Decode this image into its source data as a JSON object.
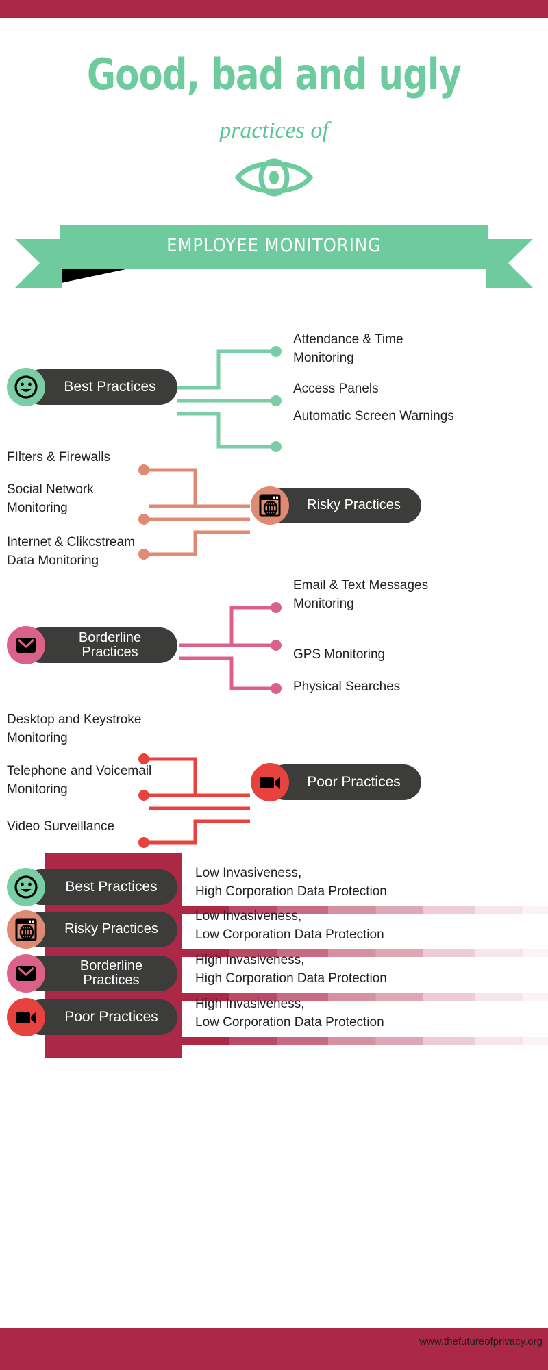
{
  "brand": {
    "bar_color": "#AB2847",
    "accent_green": "#6DCB9E",
    "footer_url": "www.thefutureofprivacy.org"
  },
  "hero": {
    "title": "Good, bad and ugly",
    "subtitle": "practices of",
    "eye_icon": "eye-icon",
    "ribbon_label": "EMPLOYEE MONITORING"
  },
  "branches": [
    {
      "key": "best",
      "label": "Best Practices",
      "icon": "smiley-face-icon",
      "color": "#7ACEA5",
      "side": "right",
      "items": [
        "Attendance & Time Monitoring",
        "Access Panels",
        "Automatic Screen Warnings"
      ]
    },
    {
      "key": "risky",
      "label": "Risky Practices",
      "icon": "browser-globe-icon",
      "color": "#DF8A72",
      "side": "left",
      "items": [
        "FIlters & Firewalls",
        "Social Network Monitoring",
        "Internet & Clikcstream Data Monitoring"
      ]
    },
    {
      "key": "borderline",
      "label": "Borderline Practices",
      "icon": "envelope-icon",
      "color": "#DC6189",
      "side": "right",
      "items": [
        "Email & Text Messages Monitoring",
        "GPS Monitoring",
        "Physical Searches"
      ]
    },
    {
      "key": "poor",
      "label": "Poor Practices",
      "icon": "video-camera-icon",
      "color": "#E8423E",
      "side": "left",
      "items": [
        "Desktop and Keystroke Monitoring",
        "Telephone and Voicemail Monitoring",
        "Video Surveillance"
      ]
    }
  ],
  "summary": {
    "rows": [
      {
        "label": "Best Practices",
        "icon": "smiley-face-icon",
        "color": "#7ACEA5",
        "line1": "Low Invasiveness,",
        "line2": "High Corporation Data Protection"
      },
      {
        "label": "Risky Practices",
        "icon": "browser-globe-icon",
        "color": "#DF8A72",
        "line1": "Low Invasiveness,",
        "line2": "Low Corporation Data Protection"
      },
      {
        "label": "Borderline Practices",
        "icon": "envelope-icon",
        "color": "#DC6189",
        "line1": "High Invasiveness,",
        "line2": "High Corporation Data Protection"
      },
      {
        "label": "Poor Practices",
        "icon": "video-camera-icon",
        "color": "#E8423E",
        "line1": "High Invasiveness,",
        "line2": "Low Corporation Data Protection"
      }
    ]
  }
}
